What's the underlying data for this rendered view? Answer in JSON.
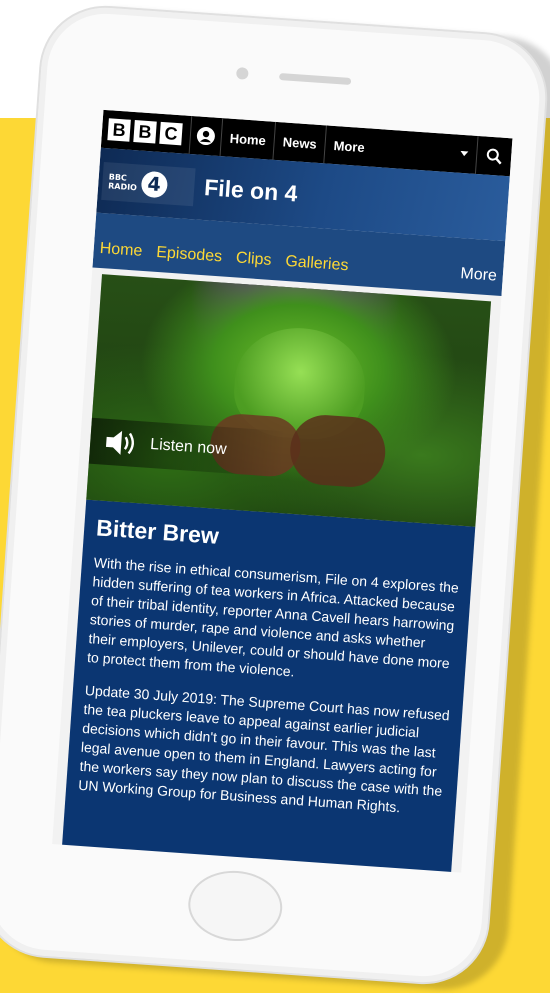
{
  "nav": {
    "bbc_letters": [
      "B",
      "B",
      "C"
    ],
    "links": [
      "Home",
      "News"
    ],
    "more_label": "More"
  },
  "radio": {
    "logo_line1": "BBC",
    "logo_line2": "RADIO",
    "logo_number": "4",
    "show_title": "File on 4"
  },
  "subnav": {
    "items": [
      "Home",
      "Episodes",
      "Clips",
      "Galleries"
    ],
    "more_label": "More"
  },
  "hero": {
    "listen_label": "Listen now"
  },
  "episode": {
    "title": "Bitter Brew",
    "paragraph1": "With the rise in ethical consumerism, File on 4 explores the hidden suffering of tea workers in Africa. Attacked because of their tribal identity, reporter Anna Cavell hears harrowing stories of murder, rape and violence and asks whether their employers, Unilever, could or should have done more to protect them from the violence.",
    "paragraph2": "Update 30 July 2019: The Supreme Court has now refused the tea pluckers leave to appeal against earlier judicial decisions which didn't go in their favour. This was the last legal avenue open to them in England. Lawyers acting for the workers say they now plan to discuss the case with the UN Working Group for Business and Human Rights."
  },
  "colors": {
    "accent_yellow": "#fdd835",
    "bbc_navy": "#0b3672",
    "subnav_blue": "#1e4a82"
  }
}
